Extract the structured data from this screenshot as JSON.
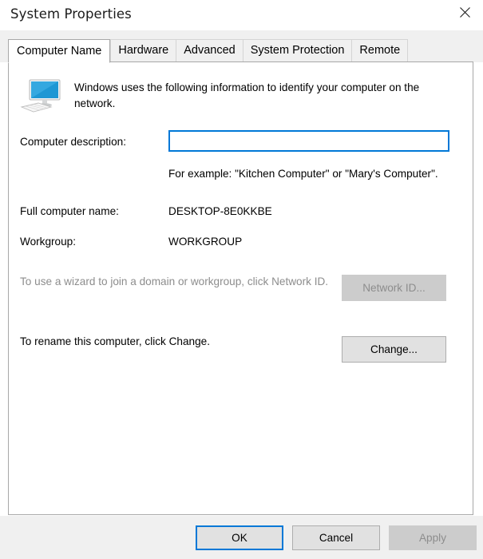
{
  "window": {
    "title": "System Properties",
    "close_icon": "close-icon"
  },
  "tabs": [
    {
      "label": "Computer Name",
      "active": true
    },
    {
      "label": "Hardware",
      "active": false
    },
    {
      "label": "Advanced",
      "active": false
    },
    {
      "label": "System Protection",
      "active": false
    },
    {
      "label": "Remote",
      "active": false
    }
  ],
  "panel": {
    "icon": "computer-monitor-icon",
    "intro_text": "Windows uses the following information to identify your computer on the network.",
    "description": {
      "label": "Computer description:",
      "value": "",
      "placeholder": "",
      "example_text": "For example: \"Kitchen Computer\" or \"Mary's Computer\"."
    },
    "full_computer_name": {
      "label": "Full computer name:",
      "value": "DESKTOP-8E0KKBE"
    },
    "workgroup": {
      "label": "Workgroup:",
      "value": "WORKGROUP"
    },
    "wizard": {
      "text": "To use a wizard to join a domain or workgroup, click Network ID.",
      "button_label": "Network ID...",
      "button_enabled": false
    },
    "rename": {
      "text": "To rename this computer, click Change.",
      "button_label": "Change...",
      "button_enabled": true
    }
  },
  "footer": {
    "ok_label": "OK",
    "cancel_label": "Cancel",
    "apply_label": "Apply",
    "apply_enabled": false
  },
  "colors": {
    "accent": "#0078d7",
    "dialog_bg": "#f0f0f0",
    "panel_bg": "#ffffff",
    "button_bg": "#e1e1e1",
    "disabled_text": "#8d8d8d",
    "disabled_button_bg": "#cccccc"
  }
}
